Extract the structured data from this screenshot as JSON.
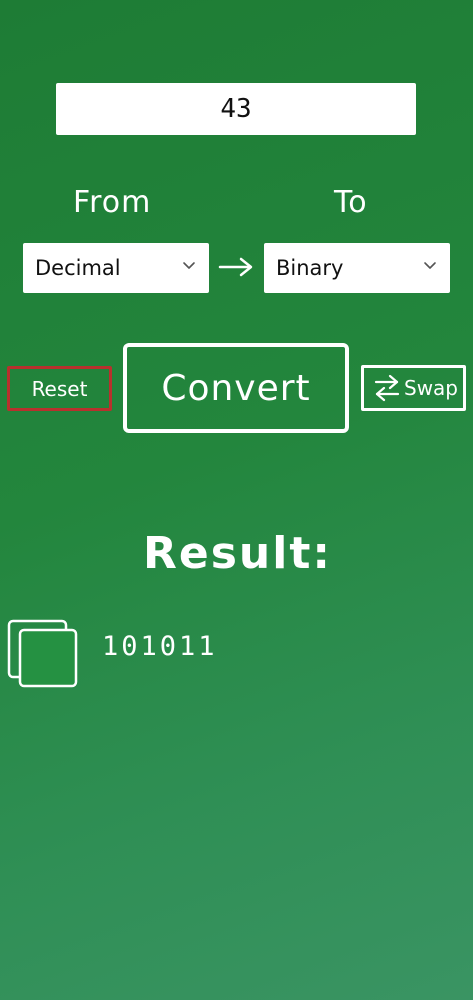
{
  "input": {
    "value": "43"
  },
  "labels": {
    "from": "From",
    "to": "To"
  },
  "from_select": {
    "selected": "Decimal",
    "icon": "chevron-down-icon"
  },
  "to_select": {
    "selected": "Binary",
    "icon": "chevron-down-icon"
  },
  "arrow_icon": "arrow-right-icon",
  "buttons": {
    "reset": "Reset",
    "convert": "Convert",
    "swap": "Swap"
  },
  "swap_icon": "swap-arrows-icon",
  "result": {
    "heading": "Result:",
    "value": "101011",
    "copy_icon": "copy-icon"
  },
  "colors": {
    "background": "#23863d",
    "reset_border": "#b8312d",
    "foreground": "#ffffff"
  }
}
